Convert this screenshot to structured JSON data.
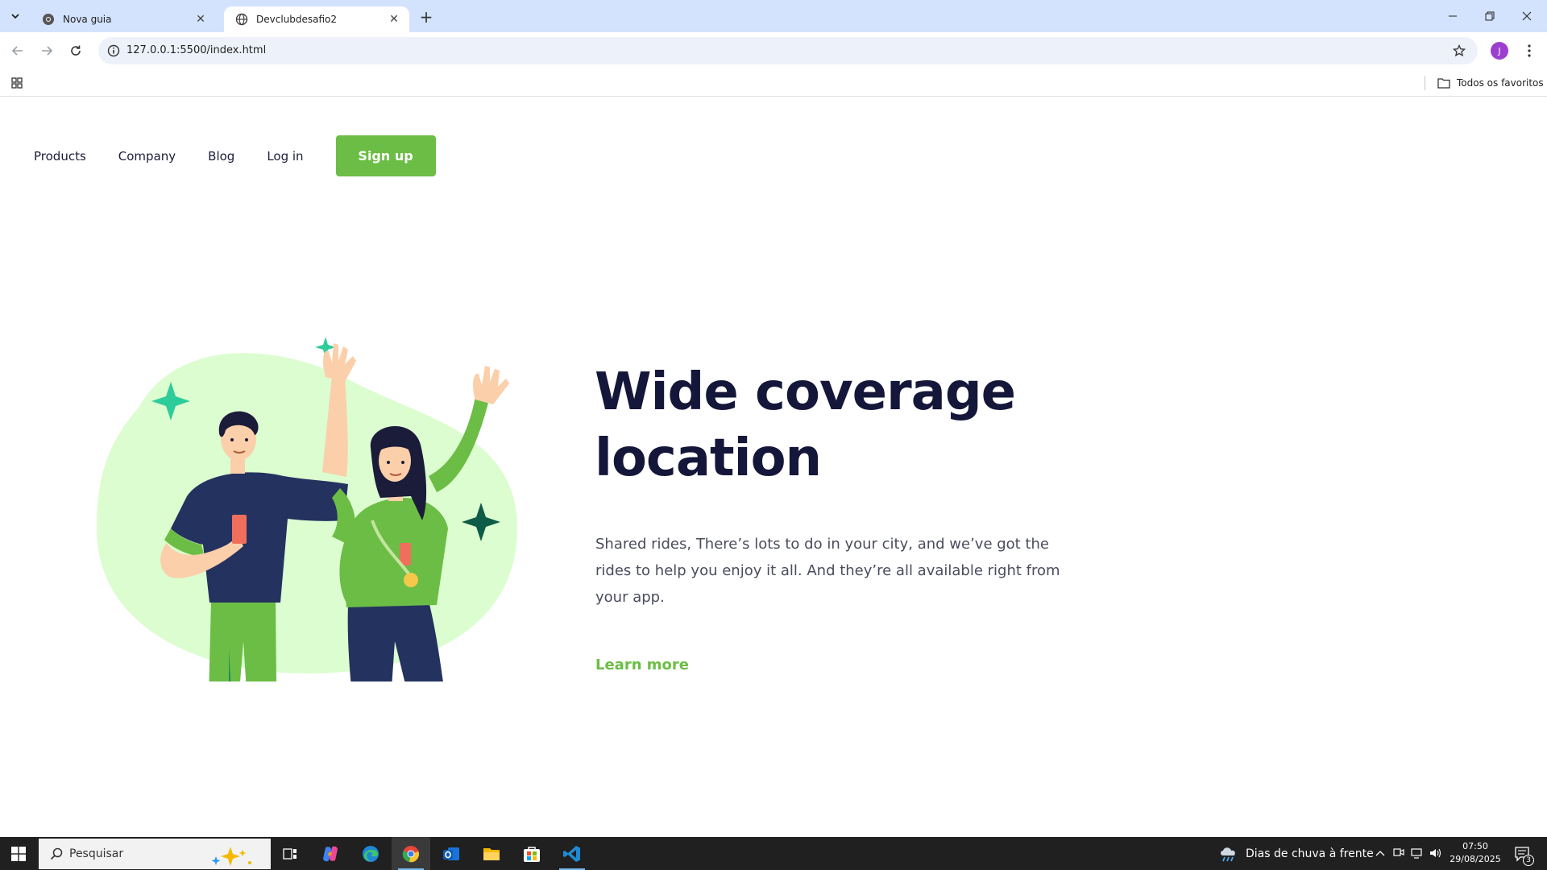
{
  "browser": {
    "tabs": [
      {
        "title": "Nova guia",
        "active": false
      },
      {
        "title": "Devclubdesafio2",
        "active": true
      }
    ],
    "url": "127.0.0.1:5500/index.html",
    "profile_initial": "J",
    "bookmarks_all_label": "Todos os favoritos"
  },
  "page": {
    "nav": {
      "items": [
        "Products",
        "Company",
        "Blog",
        "Log in"
      ],
      "signup_label": "Sign up"
    },
    "hero": {
      "title_line1": "Wide coverage",
      "title_line2": "location",
      "description": "Shared rides, There’s lots to do in your city, and we’ve got the rides to help you enjoy it all. And they’re all available right from your app.",
      "cta_label": "Learn more"
    },
    "colors": {
      "accent": "#6cbd45",
      "title": "#14163a",
      "blob": "#dcfdd0",
      "sparkle_teal": "#2ecc9a",
      "sparkle_dark": "#0e5b48"
    }
  },
  "taskbar": {
    "search_placeholder": "Pesquisar",
    "weather": "Dias de chuva à frente",
    "time": "07:50",
    "date": "29/08/2025",
    "notifications": "3",
    "apps": [
      "task-view-icon",
      "copilot-icon",
      "edge-icon",
      "chrome-icon",
      "outlook-icon",
      "file-explorer-icon",
      "store-icon",
      "vscode-icon"
    ]
  }
}
